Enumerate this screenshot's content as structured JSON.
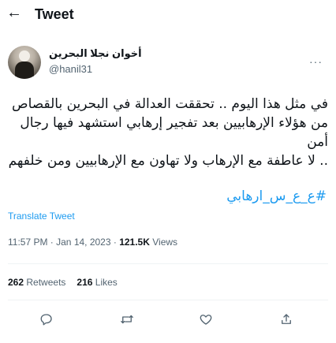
{
  "header": {
    "back_icon": "arrow-left-icon",
    "title": "Tweet"
  },
  "author": {
    "name": "أخوان نجلا البحرين",
    "handle": "@hanil31",
    "more_icon": "more-horizontal-icon"
  },
  "tweet": {
    "lines": [
      "في مثل هذا اليوم .. تحققت العدالة في البحرين بالقصاص",
      "من هؤلاء الإرهابيين بعد تفجير إرهابي استشهد فيها رجال أمن",
      ".. لا عاطفة مع الإرهاب ولا تهاون مع الإرهابيين ومن خلفهم"
    ],
    "hashtag": "#ع_ع_س_ارهابي",
    "translate_label": "Translate Tweet",
    "timestamp": "11:57 PM · Jan 14, 2023 · ",
    "views_count": "121.5K",
    "views_label": " Views"
  },
  "stats": {
    "retweets_count": "262",
    "retweets_label": "Retweets",
    "likes_count": "216",
    "likes_label": "Likes"
  },
  "actions": {
    "reply_icon": "reply-icon",
    "retweet_icon": "retweet-icon",
    "like_icon": "heart-icon",
    "share_icon": "share-icon"
  },
  "colors": {
    "accent": "#1d9bf0",
    "secondary_text": "#536471",
    "divider": "#eff3f4"
  }
}
